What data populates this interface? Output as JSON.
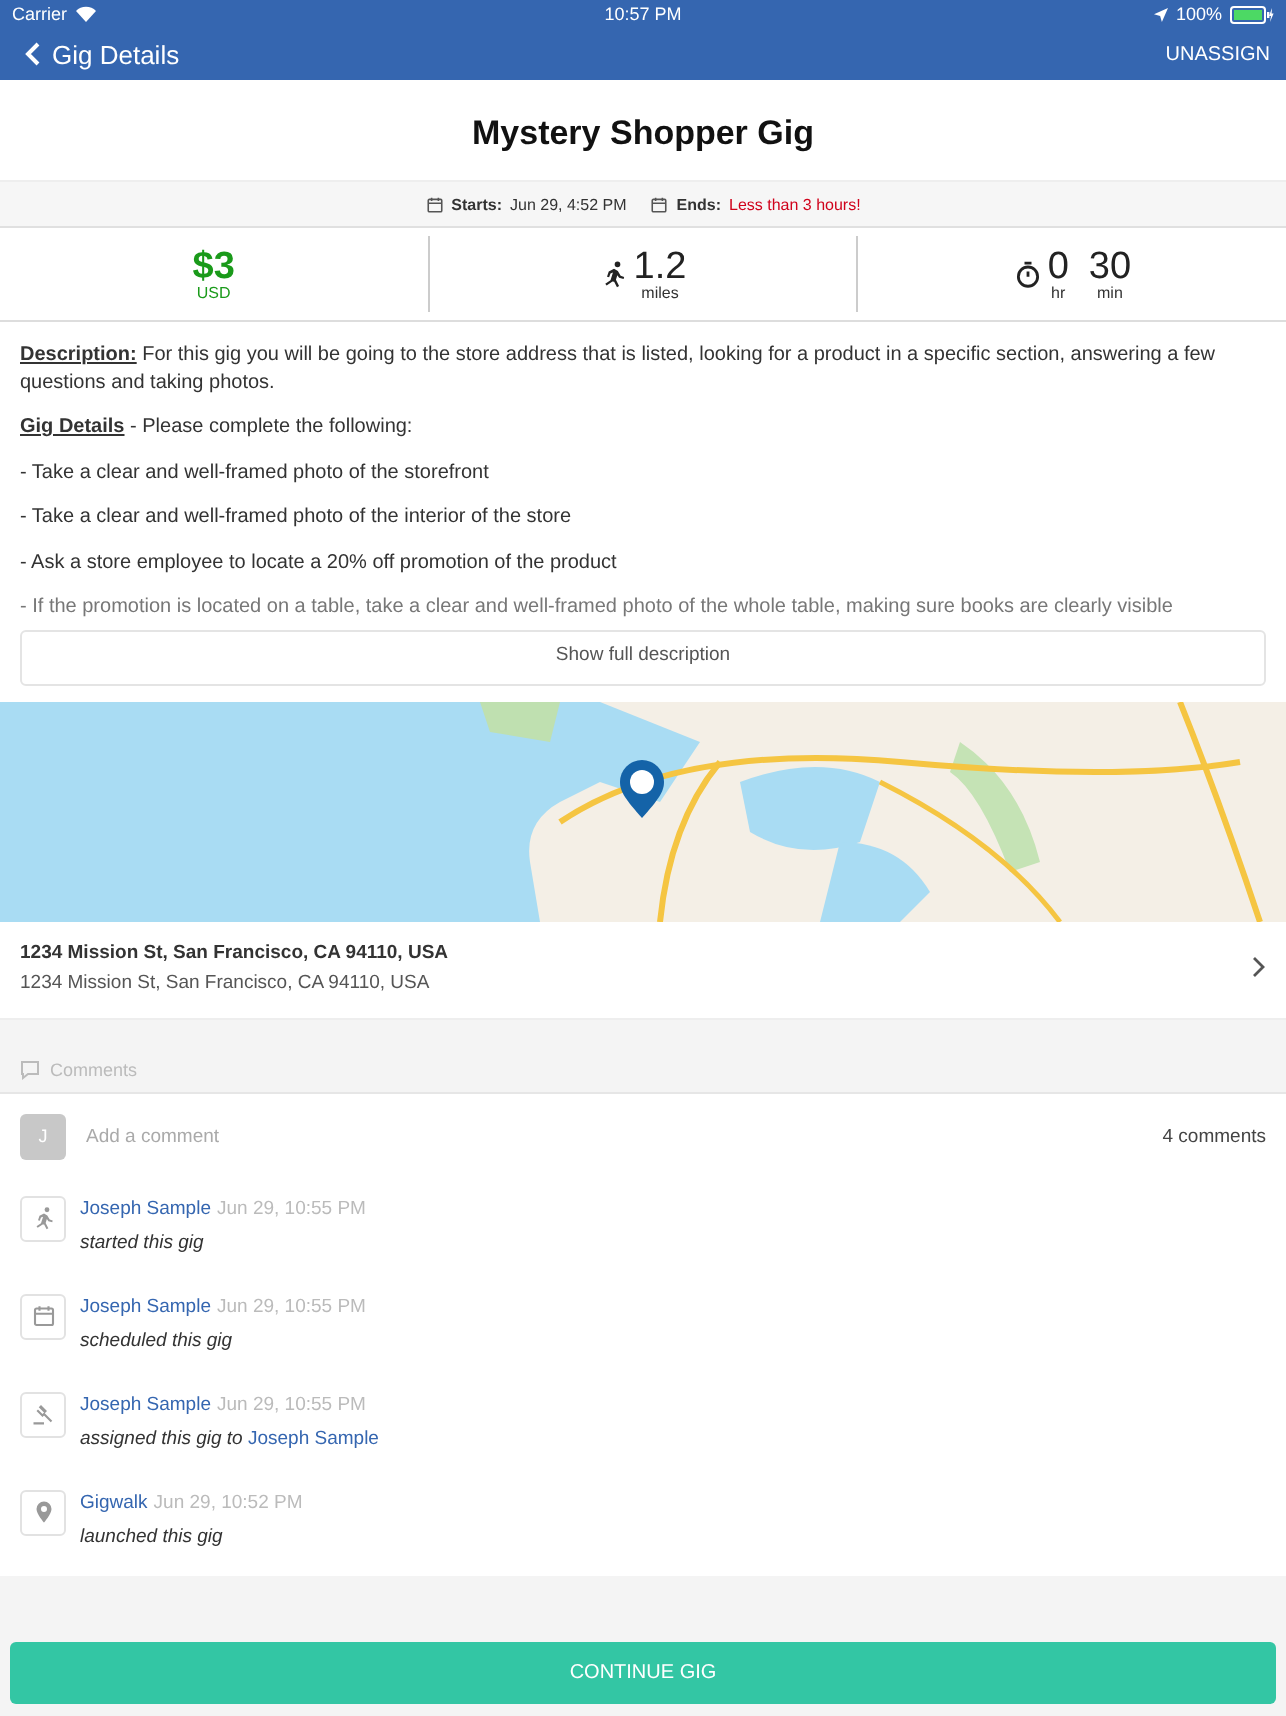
{
  "status_bar": {
    "carrier": "Carrier",
    "time": "10:57 PM",
    "battery": "100%"
  },
  "nav": {
    "back_label": "Gig Details",
    "action": "UNASSIGN"
  },
  "title": "Mystery Shopper Gig",
  "schedule": {
    "starts_label": "Starts:",
    "starts": "Jun 29, 4:52 PM",
    "ends_label": "Ends:",
    "ends": "Less than 3 hours!"
  },
  "stats": {
    "pay": "$3",
    "currency": "USD",
    "distance": "1.2",
    "distance_unit": "miles",
    "hours": "0",
    "hours_unit": "hr",
    "minutes": "30",
    "minutes_unit": "min"
  },
  "description": {
    "paragraphs": [
      {
        "label": "Description:",
        "text": " For this gig you will be going to the store address that is listed, looking for a product in a specific section, answering a few questions and taking photos.",
        "faded": false
      },
      {
        "label": "Gig Details",
        "text": " - Please complete the following:",
        "faded": false
      },
      {
        "text": "- Take a clear and well-framed photo of the storefront",
        "faded": false
      },
      {
        "text": "- Take a clear and well-framed photo of the interior of the store",
        "faded": false
      },
      {
        "text": "- Ask a store employee to locate a 20% off promotion of the product",
        "faded": false
      },
      {
        "text": "- If the promotion is located on a table, take a clear and well-framed photo of the whole table, making sure books are clearly visible",
        "faded": true
      }
    ],
    "button": "Show full description"
  },
  "address": {
    "line1": "1234 Mission St, San Francisco, CA 94110, USA",
    "line2": "1234 Mission St, San Francisco, CA 94110, USA"
  },
  "comments": {
    "header": "Comments",
    "avatar": "J",
    "placeholder": "Add a comment",
    "count": "4 comments",
    "activity": [
      {
        "kind": "start",
        "user": "Joseph Sample",
        "time": "Jun 29, 10:55 PM",
        "action": "started this gig"
      },
      {
        "kind": "schedule",
        "user": "Joseph Sample",
        "time": "Jun 29, 10:55 PM",
        "action": "scheduled this gig"
      },
      {
        "kind": "assign",
        "user": "Joseph Sample",
        "time": "Jun 29, 10:55 PM",
        "action": "assigned this gig to ",
        "target": "Joseph Sample"
      },
      {
        "kind": "launch",
        "user": "Gigwalk",
        "time": "Jun 29, 10:52 PM",
        "action": "launched this gig"
      }
    ]
  },
  "continue_button": "CONTINUE GIG"
}
